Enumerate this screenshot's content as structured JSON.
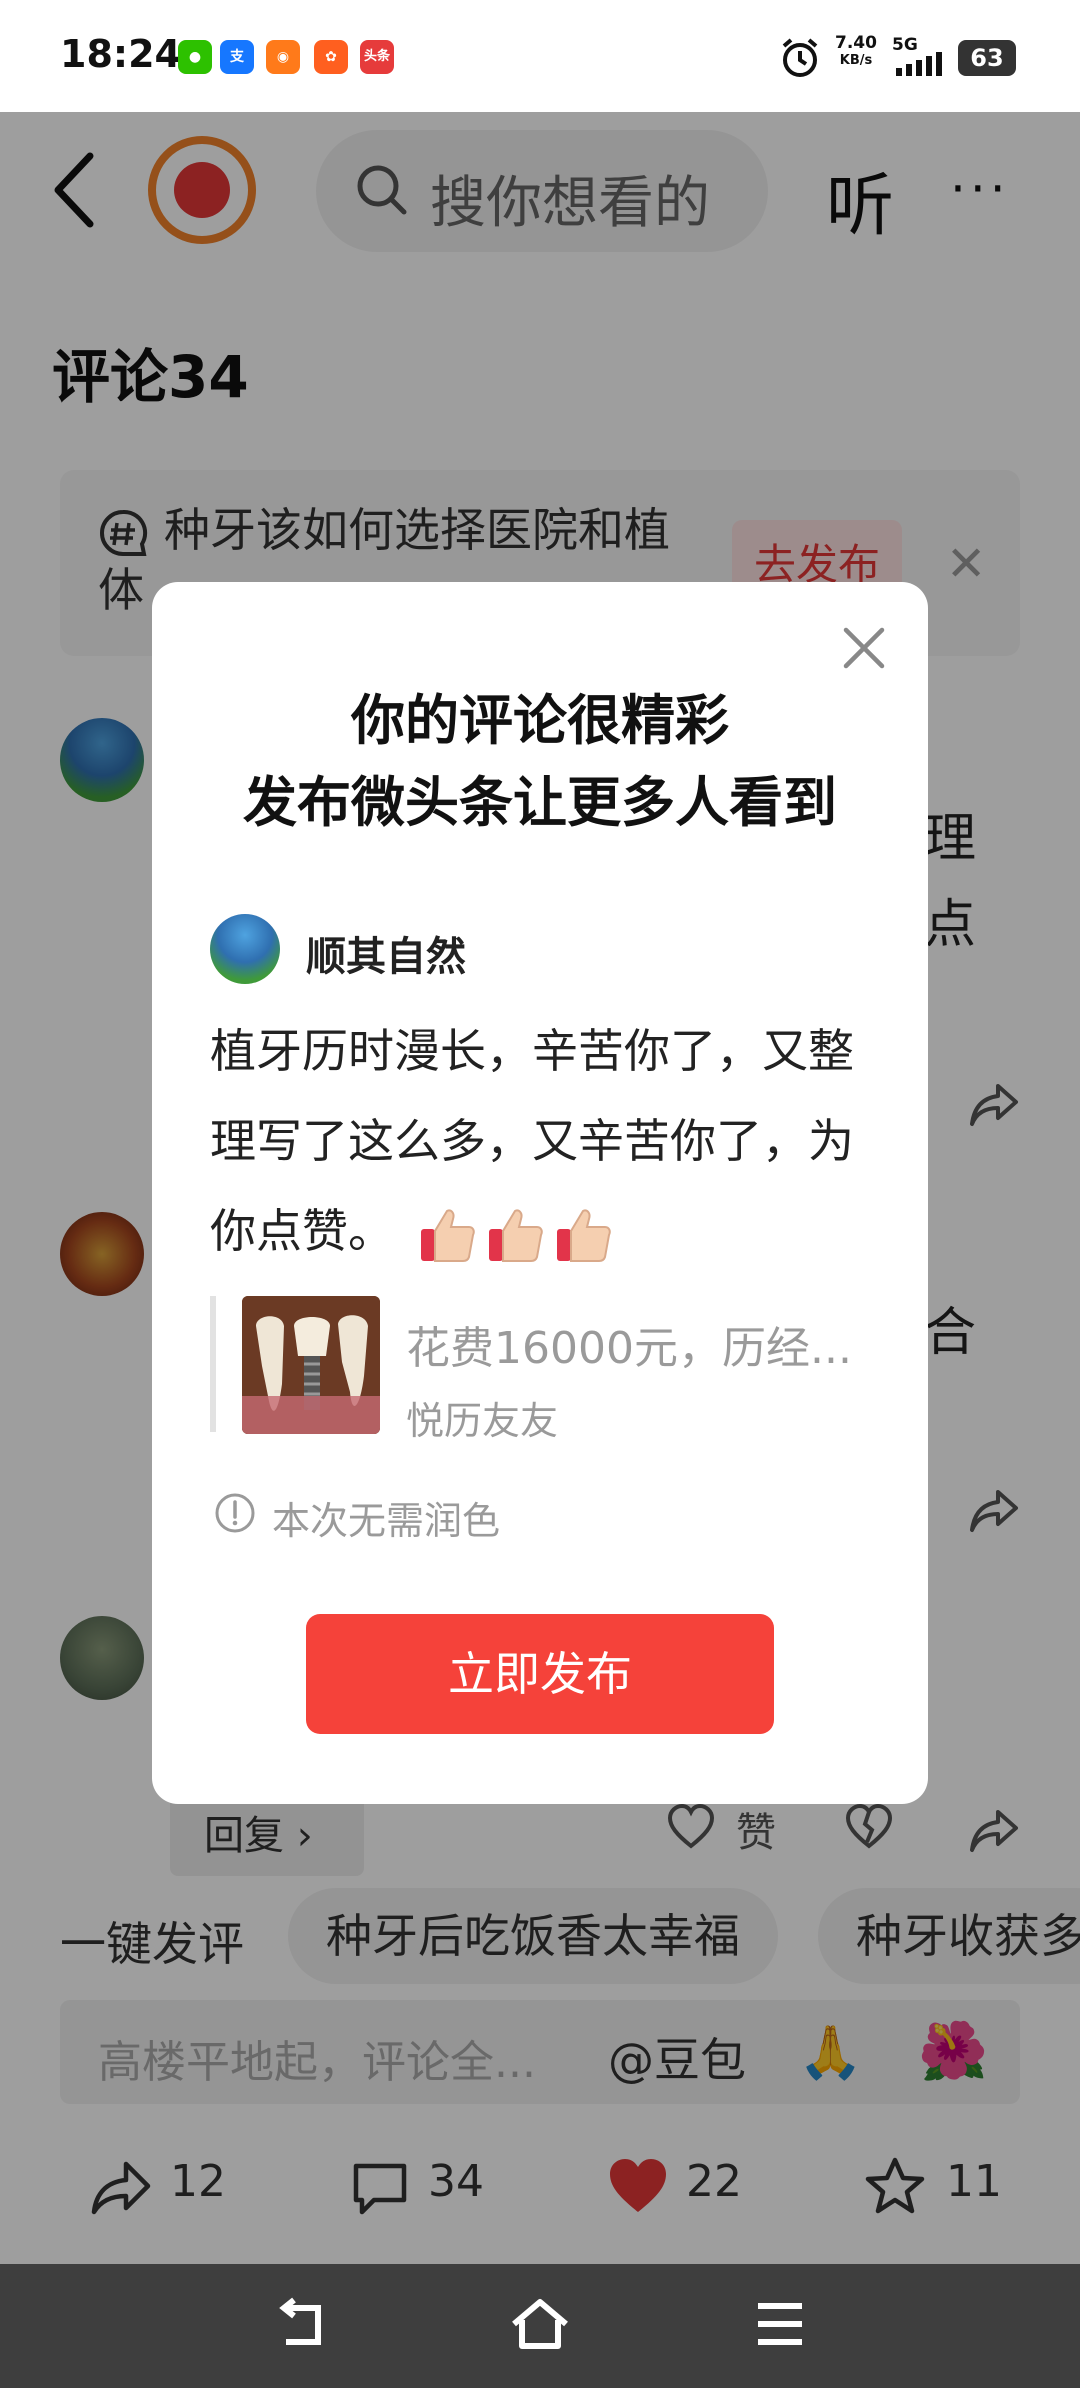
{
  "status_bar": {
    "time": "18:24",
    "app_icons": [
      "wechat-icon",
      "alipay-icon",
      "taobao-icon",
      "app-icon",
      "toutiao-icon"
    ],
    "toutiao_label": "头条",
    "net_speed_value": "7.40",
    "net_speed_unit": "KB/s",
    "network_type": "5G",
    "battery": "63"
  },
  "header": {
    "search_placeholder": "搜你想看的",
    "listen_label": "听",
    "more_label": "···"
  },
  "comments": {
    "title": "评论",
    "count": "34",
    "topic_text": "种牙该如何选择医院和植体",
    "go_post_label": "去发布",
    "fragments": [
      "理",
      "点",
      "合"
    ],
    "reply_label": "回复 ›",
    "like_label": "赞"
  },
  "quick": {
    "label": "一键发评",
    "chips": [
      "种牙后吃饭香太幸福",
      "种牙收获多"
    ]
  },
  "input": {
    "placeholder": "高楼平地起，评论全...",
    "doubao_label": "@豆包"
  },
  "bottom_actions": {
    "share_count": "12",
    "comment_count": "34",
    "like_count": "22",
    "favorite_count": "11"
  },
  "modal": {
    "title_line1": "你的评论很精彩",
    "title_line2": "发布微头条让更多人看到",
    "user_name": "顺其自然",
    "comment_text": "植牙历时漫长，辛苦你了，又整理写了这么多，又辛苦你了，为你点赞。",
    "quote_title": "花费16000元，历经...",
    "quote_author": "悦历友友",
    "no_polish_text": "本次无需润色",
    "publish_label": "立即发布"
  },
  "colors": {
    "accent_red": "#f5423a",
    "overlay": "rgba(0,0,0,0.38)",
    "like_heart": "#e23838"
  }
}
